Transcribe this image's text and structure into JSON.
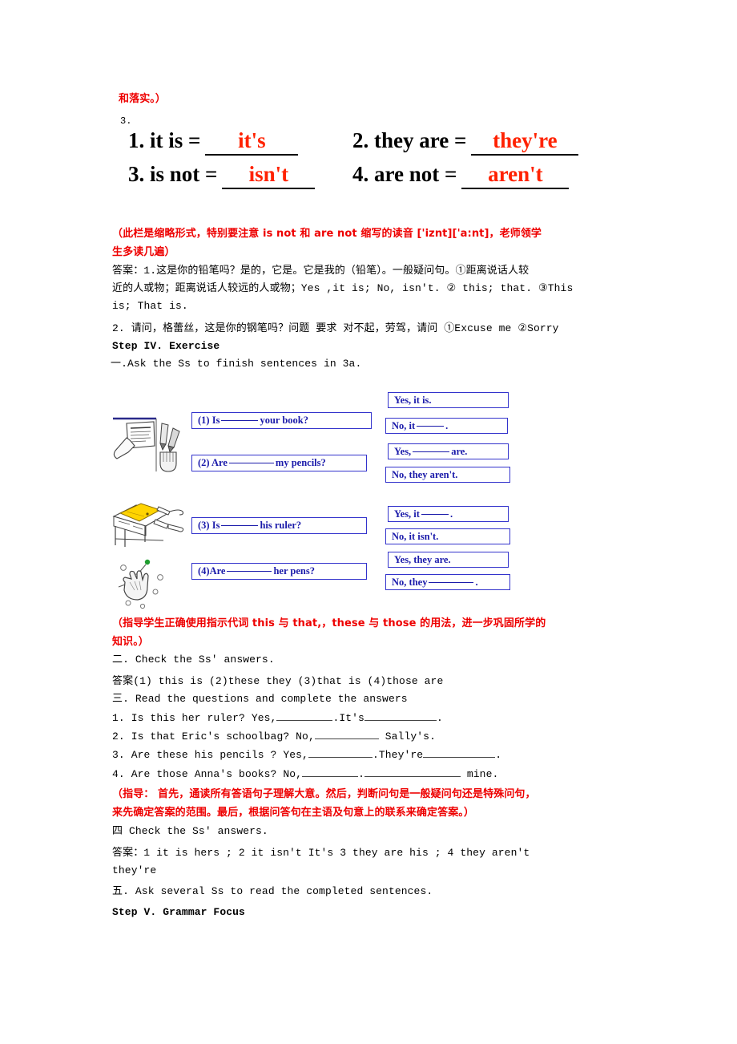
{
  "document": {
    "top_note": "和落实。）",
    "section_number": "3."
  },
  "contractions": {
    "rows": [
      [
        {
          "label": "1. it is =",
          "answer": "it's"
        },
        {
          "label": "2. they are =",
          "answer": "they're"
        }
      ],
      [
        {
          "label": "3. is not =",
          "answer": "isn't"
        },
        {
          "label": "4. are not =",
          "answer": "aren't"
        }
      ]
    ]
  },
  "notes": {
    "note1_line1": "（此栏是缩略形式，特别要注意 is not 和 are not 缩写的读音 ['iznt]['a:nt]，老师领学",
    "note1_line2": "生多读几遍）",
    "answer1_line1": "答案：1.这是你的铅笔吗？是的，它是。它是我的（铅笔）。一般疑问句。①距离说话人较",
    "answer1_line2": "近的人或物；距离说话人较远的人或物；Yes ,it is; No, isn't. ② this; that. ③This",
    "answer1_line3": "is; That is.",
    "answer2_line1": "2. 请问，格蕾丝，这是你的钢笔吗？问题 要求 对不起，劳驾，请问 ①Excuse me ②Sorry"
  },
  "step4": {
    "heading": "Step IV. Exercise",
    "task1": "一.Ask the Ss to finish sentences in 3a."
  },
  "exercise": {
    "questions": [
      {
        "id": "q1",
        "prefix": "(1) Is",
        "blank": "blank-m",
        "suffix": "your book?"
      },
      {
        "id": "q2",
        "prefix": "(2) Are",
        "blank": "blank-l",
        "suffix": "my pencils?"
      },
      {
        "id": "q3",
        "prefix": "(3) Is",
        "blank": "blank-m",
        "suffix": "his ruler?"
      },
      {
        "id": "q4",
        "prefix": "(4)Are",
        "blank": "blank-l",
        "suffix": "her pens?"
      }
    ],
    "answers": [
      {
        "id": "a1",
        "prefix": "Yes, it is.",
        "blank": "none",
        "suffix": ""
      },
      {
        "id": "a2",
        "prefix": "No, it",
        "blank": "blank-s",
        "suffix": "."
      },
      {
        "id": "a3",
        "prefix": "Yes,",
        "blank": "blank-m",
        "suffix": "are."
      },
      {
        "id": "a4",
        "prefix": "No, they aren't.",
        "blank": "none",
        "suffix": ""
      },
      {
        "id": "a5",
        "prefix": "Yes, it",
        "blank": "blank-s",
        "suffix": "."
      },
      {
        "id": "a6",
        "prefix": "No, it isn't.",
        "blank": "none",
        "suffix": ""
      },
      {
        "id": "a7",
        "prefix": "Yes, they are.",
        "blank": "none",
        "suffix": ""
      },
      {
        "id": "a8",
        "prefix": "No, they",
        "blank": "blank-l",
        "suffix": "."
      }
    ],
    "illustration_captions": [
      "hand-holding-book-and-pencils-illustration",
      "desk-with-ruler-and-pens-illustration",
      "hand-pointing-illustration"
    ]
  },
  "notes2": {
    "note2_line1": "（指导学生正确使用指示代词 this 与 that,，these 与 those 的用法，进一步巩固所学的",
    "note2_line2": "知识。）",
    "task2": "二. Check the Ss' answers.",
    "answer_key2": "答案(1) this  is  (2)these  they   (3)that  is   (4)those  are"
  },
  "task3": {
    "heading": "三. Read the questions and complete the answers",
    "items": [
      {
        "n": "1.",
        "a": "Is this her ruler? Yes,",
        "b": ".It's",
        "c": "."
      },
      {
        "n": "2.",
        "a": "Is that Eric's schoolbag? No,",
        "b": "Sally's.",
        "c": ""
      },
      {
        "n": "3.",
        "a": "Are these his pencils ? Yes,",
        "b": ".They're",
        "c": "."
      },
      {
        "n": "4.",
        "a": "Are those Anna's books? No,",
        "b": ".",
        "c": "mine."
      }
    ]
  },
  "notes3": {
    "note3_line1": "（指导： 首先，通读所有答语句子理解大意。然后，判断问句是一般疑问句还是特殊问句，",
    "note3_line2": "来先确定答案的范围。最后，根据问答句在主语及句意上的联系来确定答案。）",
    "task4": "四 Check the Ss' answers.",
    "answer_key3_line1": " 答案：1 it is  hers ; 2  it  isn't  It's   3  they are  his ; 4  they aren't",
    "answer_key3_line2": "they're",
    "task5": "五. Ask several Ss to read the completed sentences."
  },
  "step5": {
    "heading": "Step V. Grammar Focus"
  },
  "colors": {
    "note_red": "#ee0000",
    "answer_red": "#ff2200",
    "box_blue": "#3333cc",
    "box_text_blue": "#1a1aaa",
    "ruler_yellow": "#ffd400"
  }
}
